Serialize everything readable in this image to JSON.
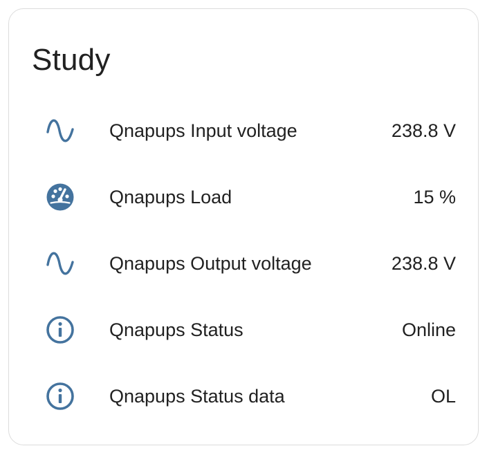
{
  "card": {
    "title": "Study"
  },
  "colors": {
    "icon": "#44739e",
    "text": "#212121",
    "border": "#dcdcdc"
  },
  "entities": [
    {
      "icon": "sine-wave-icon",
      "name": "Qnapups Input voltage",
      "state": "238.8 V"
    },
    {
      "icon": "gauge-icon",
      "name": "Qnapups Load",
      "state": "15 %"
    },
    {
      "icon": "sine-wave-icon",
      "name": "Qnapups Output voltage",
      "state": "238.8 V"
    },
    {
      "icon": "info-icon",
      "name": "Qnapups Status",
      "state": "Online"
    },
    {
      "icon": "info-icon",
      "name": "Qnapups Status data",
      "state": "OL"
    }
  ]
}
